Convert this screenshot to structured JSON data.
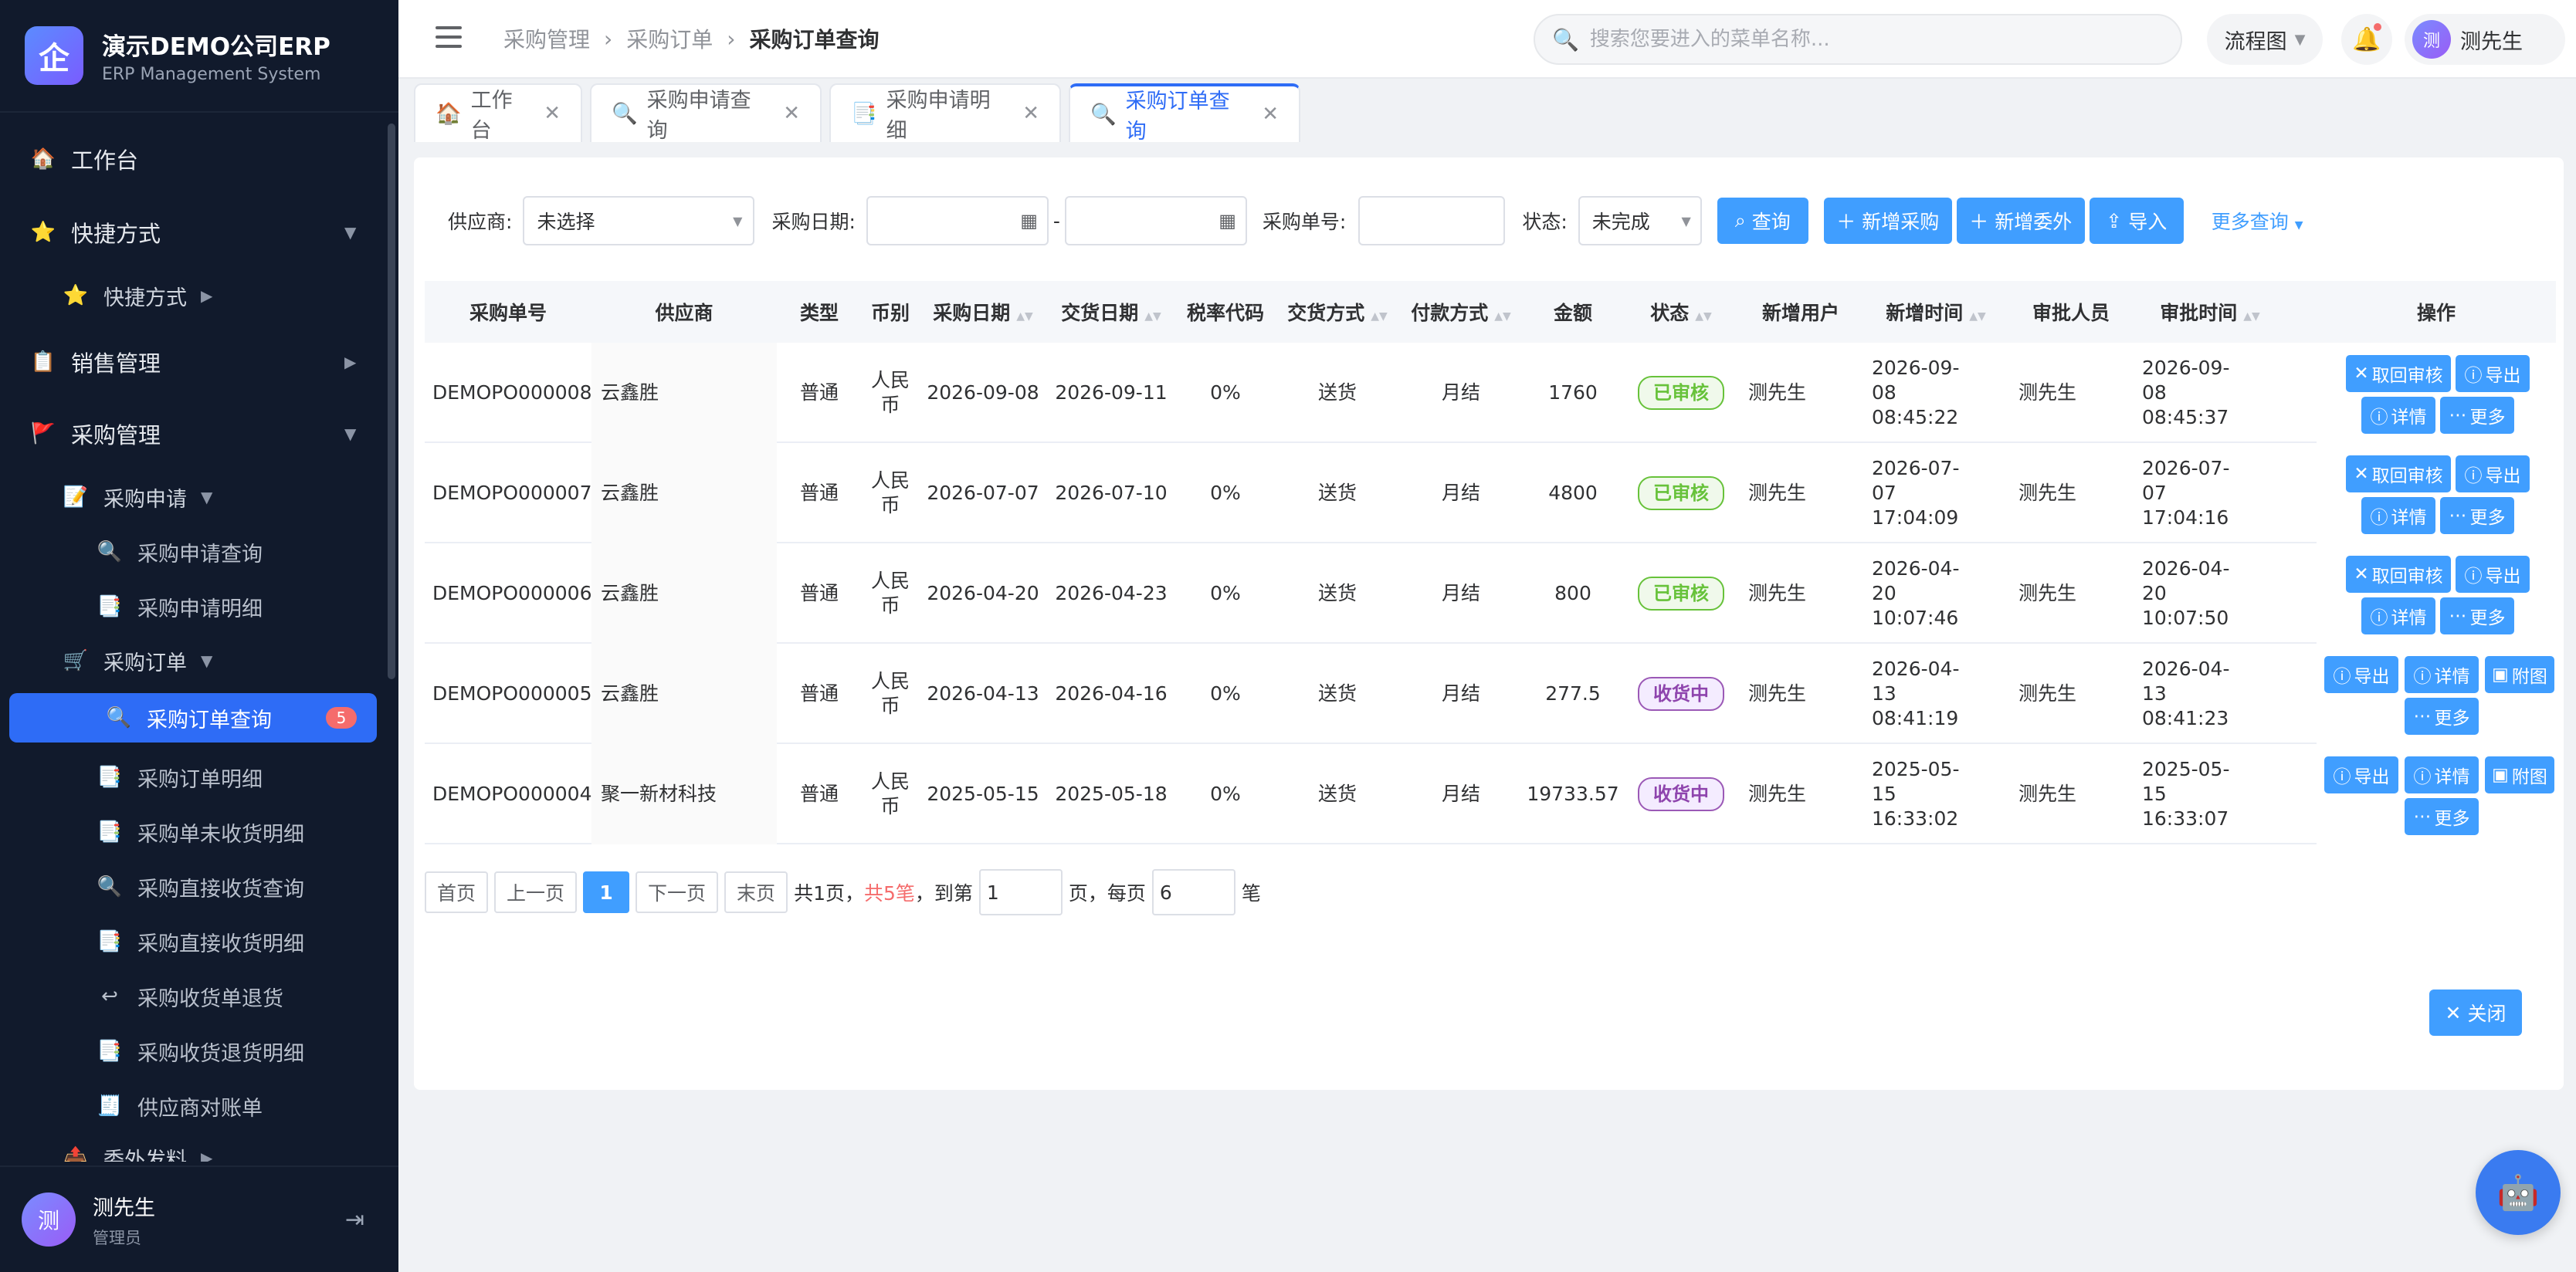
{
  "brand": {
    "title": "演示DEMO公司ERP",
    "subtitle": "ERP Management System",
    "logo": "企"
  },
  "sidebar": {
    "items": [
      {
        "label": "工作台",
        "icon": "🏠"
      },
      {
        "label": "快捷方式",
        "icon": "⭐"
      },
      {
        "label": "快捷方式",
        "icon": "⭐"
      },
      {
        "label": "销售管理",
        "icon": "📋"
      },
      {
        "label": "采购管理",
        "icon": "🚩"
      },
      {
        "label": "采购申请",
        "icon": "📝"
      },
      {
        "label": "采购申请查询",
        "icon": "🔍"
      },
      {
        "label": "采购申请明细",
        "icon": "📑"
      },
      {
        "label": "采购订单",
        "icon": "🛒"
      },
      {
        "label": "采购订单查询",
        "icon": "🔍",
        "badge": "5"
      },
      {
        "label": "采购订单明细",
        "icon": "📑"
      },
      {
        "label": "采购单未收货明细",
        "icon": "📑"
      },
      {
        "label": "采购直接收货查询",
        "icon": "🔍"
      },
      {
        "label": "采购直接收货明细",
        "icon": "📑"
      },
      {
        "label": "采购收货单退货",
        "icon": "↩"
      },
      {
        "label": "采购收货退货明细",
        "icon": "📑"
      },
      {
        "label": "供应商对账单",
        "icon": "🧾"
      },
      {
        "label": "委外发料",
        "icon": "📤"
      }
    ]
  },
  "user": {
    "name": "测先生",
    "role": "管理员",
    "avatar": "测"
  },
  "header": {
    "breadcrumb": [
      "采购管理",
      "采购订单",
      "采购订单查询"
    ],
    "search_placeholder": "搜索您要进入的菜单名称...",
    "flow_label": "流程图",
    "user_name": "测先生"
  },
  "tabs": [
    {
      "label": "工作台",
      "icon": "🏠"
    },
    {
      "label": "采购申请查询",
      "icon": "🔍"
    },
    {
      "label": "采购申请明细",
      "icon": "📑"
    },
    {
      "label": "采购订单查询",
      "icon": "🔍"
    }
  ],
  "filters": {
    "supplier_label": "供应商:",
    "supplier_value": "未选择",
    "date_label": "采购日期:",
    "date_sep": "-",
    "order_no_label": "采购单号:",
    "status_label": "状态:",
    "status_value": "未完成",
    "query_btn": "查询",
    "add_purchase_btn": "新增采购",
    "add_outsource_btn": "新增委外",
    "import_btn": "导入",
    "more_query": "更多查询"
  },
  "table": {
    "headers": [
      "采购单号",
      "供应商",
      "类型",
      "币别",
      "采购日期",
      "交货日期",
      "税率代码",
      "交货方式",
      "付款方式",
      "金额",
      "状态",
      "新增用户",
      "新增时间",
      "审批人员",
      "审批时间",
      "操作"
    ],
    "rows": [
      {
        "no": "DEMOPO000008",
        "supplier": "云鑫胜",
        "type": "普通",
        "currency": "人民币",
        "pdate": "2026-09-08",
        "ddate": "2026-09-11",
        "tax": "0%",
        "delivery": "送货",
        "pay": "月结",
        "amount": "1760",
        "status": "已审核",
        "creator": "测先生",
        "ctime": "2026-09-08 08:45:22",
        "approver": "测先生",
        "atime": "2026-09-08 08:45:37"
      },
      {
        "no": "DEMOPO000007",
        "supplier": "云鑫胜",
        "type": "普通",
        "currency": "人民币",
        "pdate": "2026-07-07",
        "ddate": "2026-07-10",
        "tax": "0%",
        "delivery": "送货",
        "pay": "月结",
        "amount": "4800",
        "status": "已审核",
        "creator": "测先生",
        "ctime": "2026-07-07 17:04:09",
        "approver": "测先生",
        "atime": "2026-07-07 17:04:16"
      },
      {
        "no": "DEMOPO000006",
        "supplier": "云鑫胜",
        "type": "普通",
        "currency": "人民币",
        "pdate": "2026-04-20",
        "ddate": "2026-04-23",
        "tax": "0%",
        "delivery": "送货",
        "pay": "月结",
        "amount": "800",
        "status": "已审核",
        "creator": "测先生",
        "ctime": "2026-04-20 10:07:46",
        "approver": "测先生",
        "atime": "2026-04-20 10:07:50"
      },
      {
        "no": "DEMOPO000005",
        "supplier": "云鑫胜",
        "type": "普通",
        "currency": "人民币",
        "pdate": "2026-04-13",
        "ddate": "2026-04-16",
        "tax": "0%",
        "delivery": "送货",
        "pay": "月结",
        "amount": "277.5",
        "status": "收货中",
        "creator": "测先生",
        "ctime": "2026-04-13 08:41:19",
        "approver": "测先生",
        "atime": "2026-04-13 08:41:23"
      },
      {
        "no": "DEMOPO000004",
        "supplier": "聚一新材科技",
        "type": "普通",
        "currency": "人民币",
        "pdate": "2025-05-15",
        "ddate": "2025-05-18",
        "tax": "0%",
        "delivery": "送货",
        "pay": "月结",
        "amount": "19733.57",
        "status": "收货中",
        "creator": "测先生",
        "ctime": "2025-05-15 16:33:02",
        "approver": "测先生",
        "atime": "2025-05-15 16:33:07"
      }
    ],
    "ops_approved": [
      "取回审核",
      "导出",
      "详情",
      "更多"
    ],
    "ops_receiving": [
      "导出",
      "详情",
      "附图",
      "更多"
    ]
  },
  "pager": {
    "first": "首页",
    "prev": "上一页",
    "current": "1",
    "next": "下一页",
    "last": "末页",
    "total_pages": "共1页，",
    "total_count": "共5笔",
    "goto_label": "，到第",
    "goto_value": "1",
    "page_unit": "页，每页",
    "page_size": "6",
    "size_unit": "笔"
  },
  "close_btn": "关闭",
  "colors": {
    "primary": "#409eff",
    "sidebar_bg": "#111a2c",
    "active": "#2e6cf6",
    "approved": "#67c23a",
    "receiving": "#8e44ad"
  }
}
